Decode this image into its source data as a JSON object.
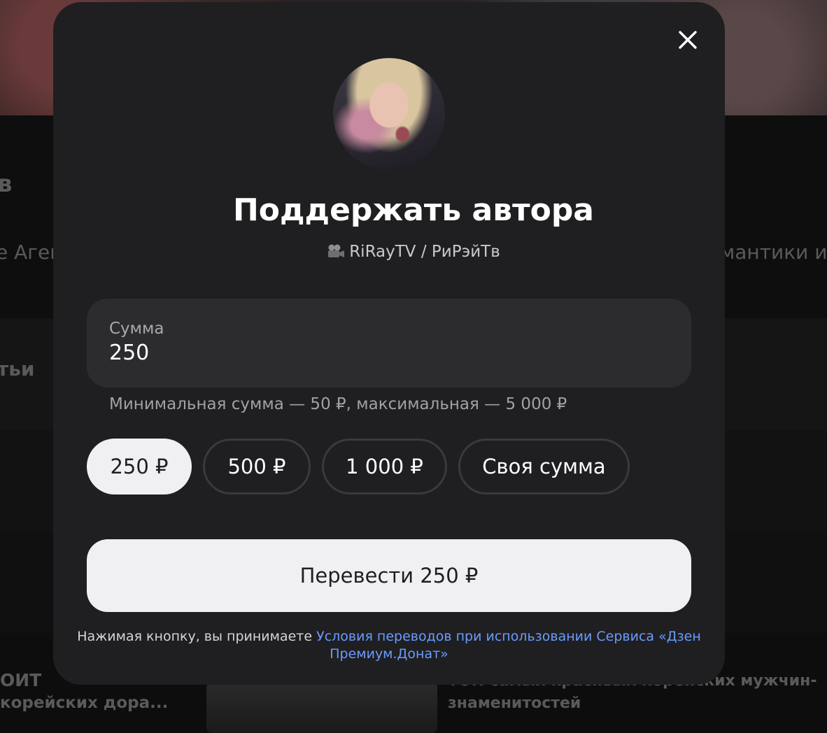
{
  "background": {
    "text_left_1": "в",
    "text_left_2": "е Аген",
    "text_right_1": "омантики и",
    "text_left_3": "тьи",
    "text_bottom_left_1": "ОИТ",
    "text_bottom_left_2": "корейских дора...",
    "text_bottom_right_1": "ТОП самых красивых корейских мужчин-",
    "text_bottom_right_2": "знаменитостей"
  },
  "modal": {
    "close_icon": "close-icon",
    "title": "Поддержать автора",
    "author": {
      "icon": "movie-camera-icon",
      "name": "RiRayTV / РиРэйТв"
    },
    "amount": {
      "label": "Сумма",
      "value": "250"
    },
    "hint": "Минимальная сумма — 50 ₽, максимальная — 5 000 ₽",
    "chips": [
      {
        "label": "250 ₽",
        "selected": true
      },
      {
        "label": "500 ₽",
        "selected": false
      },
      {
        "label": "1 000 ₽",
        "selected": false
      },
      {
        "label": "Своя сумма",
        "selected": false
      }
    ],
    "transfer_button": "Перевести 250 ₽",
    "terms": {
      "prefix": "Нажимая кнопку, вы принимаете ",
      "link": "Условия переводов при использовании Сервиса «Дзен Премиум.Донат»"
    }
  },
  "colors": {
    "modal_bg": "#1f1f21",
    "input_bg": "#2c2c2f",
    "selected_chip_bg": "#f0f0f2",
    "link": "#6b9bff"
  }
}
